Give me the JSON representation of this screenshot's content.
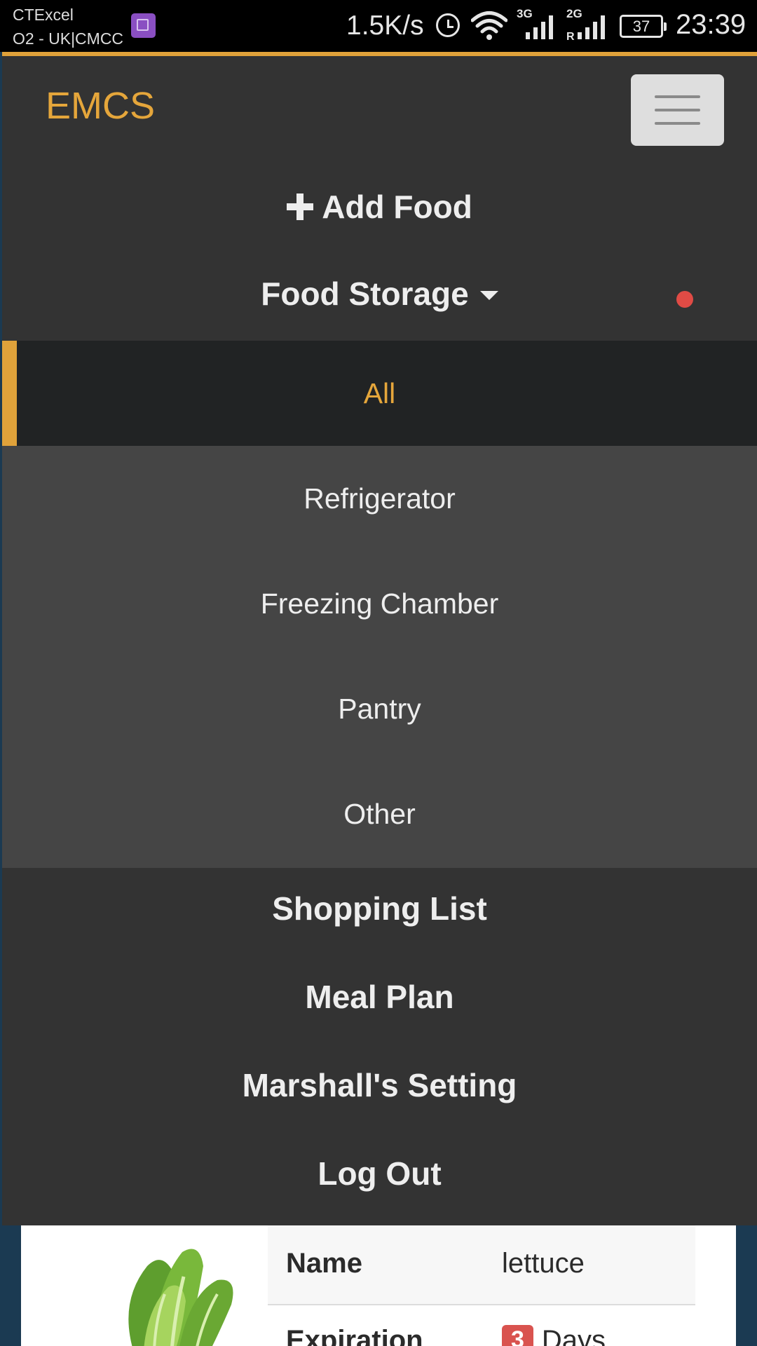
{
  "status_bar": {
    "carrier_primary": "CTExcel",
    "carrier_secondary": "O2 - UK|CMCC",
    "net_speed": "1.5K/s",
    "net_type_1": "3G",
    "net_type_2": "2G",
    "net_type_2_sub": "R",
    "battery": "37",
    "time": "23:39"
  },
  "navbar": {
    "brand": "EMCS",
    "accent_color": "#e0a23a"
  },
  "menu": {
    "add_food": "Add Food",
    "food_storage": "Food Storage",
    "storage_options": [
      "All",
      "Refrigerator",
      "Freezing Chamber",
      "Pantry",
      "Other"
    ],
    "active_storage": "All",
    "shopping_list": "Shopping List",
    "meal_plan": "Meal Plan",
    "settings": "Marshall's Setting",
    "log_out": "Log Out",
    "notification_color": "#e04b45"
  },
  "food_card": {
    "name_label": "Name",
    "name_value": "lettuce",
    "expiration_label": "Expiration",
    "days_count": "3",
    "days_label": "Days",
    "badge_color": "#d9534f"
  }
}
